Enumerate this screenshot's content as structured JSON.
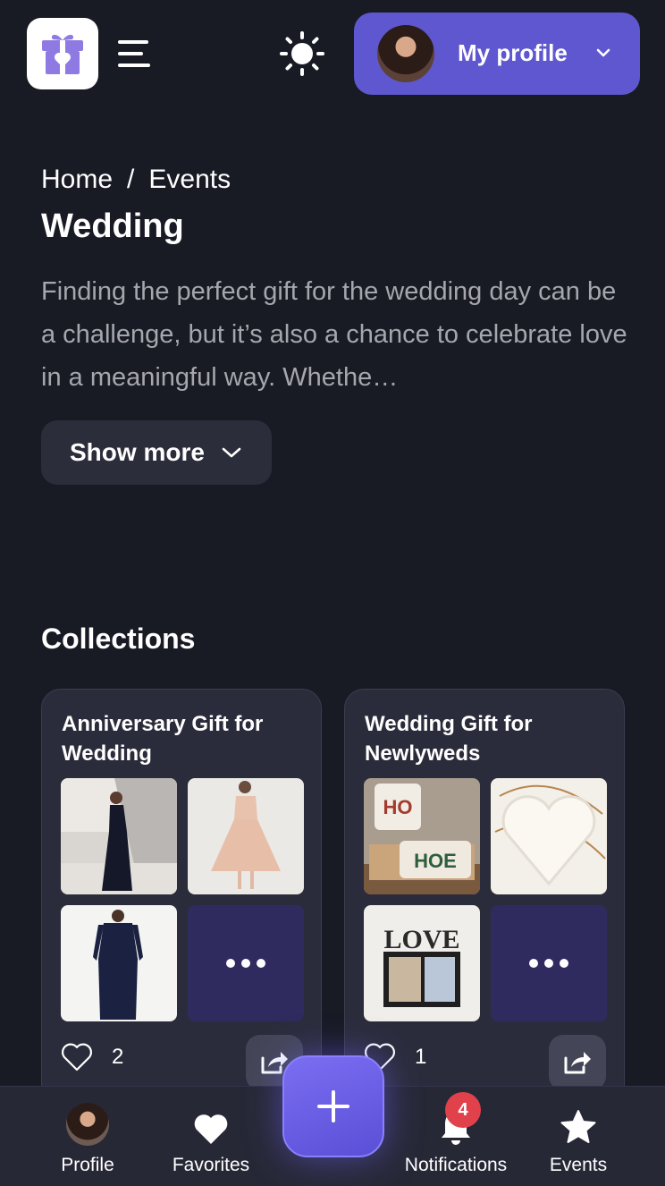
{
  "header": {
    "profile_label": "My profile",
    "icons": {
      "logo": "gift-icon",
      "menu": "hamburger-menu-icon",
      "theme": "sun-icon",
      "dropdown": "chevron-down-icon"
    }
  },
  "breadcrumb": {
    "home": "Home",
    "separator": "/",
    "current": "Events"
  },
  "page": {
    "title": "Wedding",
    "description": "Finding the perfect gift for the wedding day can be a challenge, but it’s also a chance to celebrate love in a meaningful way. Whethe…",
    "show_more_label": "Show more"
  },
  "collections": {
    "title": "Collections",
    "items": [
      {
        "title": "Anniversary Gift for Wedding",
        "likes": "2"
      },
      {
        "title": "Wedding Gift for Newlyweds",
        "likes": "1"
      }
    ]
  },
  "bottom_nav": {
    "items": [
      {
        "label": "Profile"
      },
      {
        "label": "Favorites"
      },
      {
        "label": "Notifications",
        "badge": "4"
      },
      {
        "label": "Events"
      }
    ],
    "add_icon": "plus-icon"
  },
  "colors": {
    "background": "#181a24",
    "accent": "#5f57cf",
    "card": "#2b2c3b",
    "badge": "#e0414b"
  }
}
